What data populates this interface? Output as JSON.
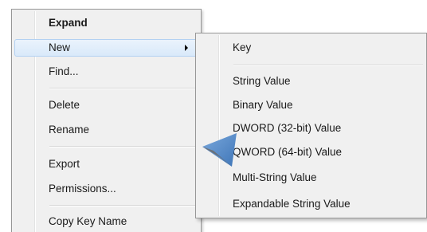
{
  "context_menu": {
    "items": [
      {
        "label": "Expand",
        "bold": true
      },
      {
        "label": "New",
        "highlighted": true,
        "has_submenu": true
      },
      {
        "label": "Find..."
      },
      {
        "label": "Delete"
      },
      {
        "label": "Rename"
      },
      {
        "label": "Export"
      },
      {
        "label": "Permissions..."
      },
      {
        "label": "Copy Key Name"
      }
    ]
  },
  "submenu": {
    "items": [
      {
        "label": "Key"
      },
      {
        "label": "String Value"
      },
      {
        "label": "Binary Value"
      },
      {
        "label": "DWORD (32-bit) Value"
      },
      {
        "label": "QWORD (64-bit) Value"
      },
      {
        "label": "Multi-String Value"
      },
      {
        "label": "Expandable String Value"
      }
    ]
  },
  "colors": {
    "menu_bg": "#f0f0f0",
    "highlight_bg": "#dcebfb",
    "highlight_border": "#b3d1f2",
    "pointer": "#5b8fc9"
  },
  "icons": {
    "submenu_arrow": "chevron-right-icon",
    "pointer": "arrow-pointer-icon"
  }
}
